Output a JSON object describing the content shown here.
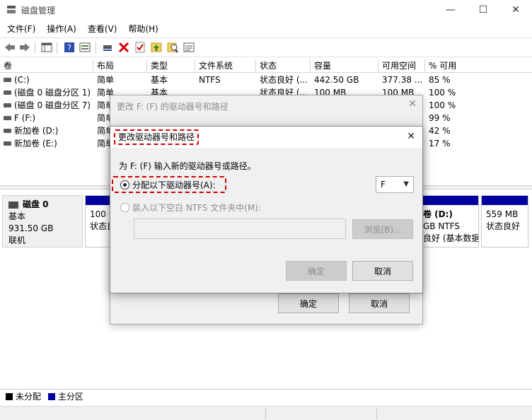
{
  "window": {
    "title": "磁盘管理",
    "controls": {
      "minimize": "—",
      "maximize": "☐",
      "close": "✕"
    }
  },
  "menu": [
    "文件(F)",
    "操作(A)",
    "查看(V)",
    "帮助(H)"
  ],
  "toolbar_icons": [
    "back-arrow-icon",
    "forward-arrow-icon",
    "console-tree-icon",
    "help-icon",
    "properties-icon",
    "connect-icon",
    "delete-icon",
    "check-icon",
    "up-arrow-icon",
    "search-icon",
    "list-icon"
  ],
  "volume_table": {
    "columns": [
      "卷",
      "布局",
      "类型",
      "文件系统",
      "状态",
      "容量",
      "可用空间",
      "% 可用"
    ],
    "rows": [
      [
        "(C:)",
        "简单",
        "基本",
        "NTFS",
        "状态良好 (...",
        "442.50 GB",
        "377.38 ...",
        "85 %"
      ],
      [
        "(磁盘 0 磁盘分区 1)",
        "简单",
        "基本",
        "",
        "状态良好 (...",
        "100 MB",
        "100 MB",
        "100 %"
      ],
      [
        "(磁盘 0 磁盘分区 7)",
        "简单",
        "",
        "",
        "",
        "",
        "",
        "100 %"
      ],
      [
        "F (F:)",
        "简单",
        "",
        "",
        "",
        "",
        "",
        "99 %"
      ],
      [
        "新加卷 (D:)",
        "简单",
        "",
        "",
        "",
        "",
        "",
        "42 %"
      ],
      [
        "新加卷 (E:)",
        "简单",
        "",
        "",
        "",
        "",
        "",
        "17 %"
      ]
    ]
  },
  "disk": {
    "name": "磁盘 0",
    "type": "基本",
    "size": "931.50 GB",
    "status": "联机"
  },
  "partitions": {
    "p1": {
      "line1": "100 M",
      "line2": "状态良"
    },
    "p_d": {
      "line0": "卷 (D:)",
      "line1": "GB NTFS",
      "line2": "良好 (基本数据"
    },
    "p_last": {
      "line1": "559 MB",
      "line2": "状态良好"
    }
  },
  "legend": {
    "unallocated": "未分配",
    "primary": "主分区"
  },
  "outer_dialog": {
    "title": "更改 F: (F) 的驱动器号和路径",
    "ok": "确定",
    "cancel": "取消"
  },
  "inner_dialog": {
    "title": "更改驱动器号和路径",
    "instruction": "为 F: (F) 输入新的驱动器号或路径。",
    "option_assign": "分配以下驱动器号(A):",
    "drive_letter": "F",
    "option_mount": "装入以下空白 NTFS 文件夹中(M):",
    "browse": "浏览(B)...",
    "ok": "确定",
    "cancel": "取消"
  },
  "colors": {
    "primary_partition": "#0000a0",
    "unallocated": "#000000",
    "highlight_dash": "#d00000"
  }
}
